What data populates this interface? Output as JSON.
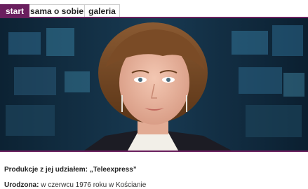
{
  "nav": {
    "tabs": [
      {
        "label": "start",
        "active": true
      },
      {
        "label": "sama o sobie",
        "active": false
      },
      {
        "label": "galeria",
        "active": false
      }
    ]
  },
  "colors": {
    "accent": "#6a1f5e",
    "studio_bg": "#0e2436"
  },
  "info": {
    "productions": "Produkcje z jej udziałem: „Teleexpress”",
    "born_label": "Urodzona:",
    "born_value": " w czerwcu 1976 roku w Kościanie"
  }
}
